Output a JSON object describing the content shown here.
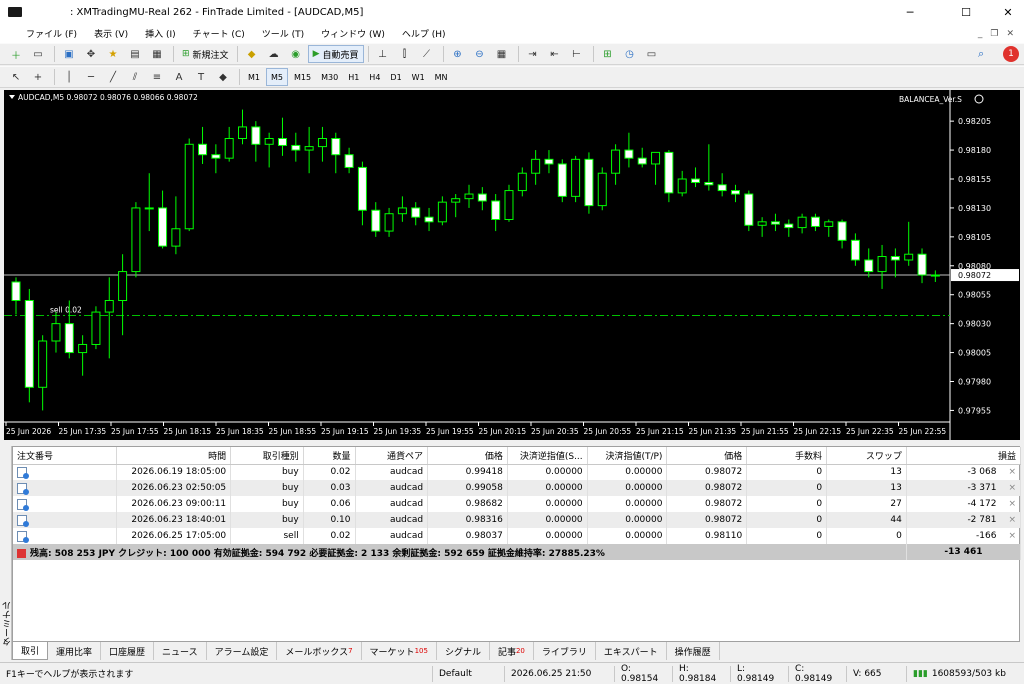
{
  "window": {
    "title": ": XMTradingMU-Real 262 - FinTrade Limited - [AUDCAD,M5]"
  },
  "menu": [
    "ファイル (F)",
    "表示 (V)",
    "挿入 (I)",
    "チャート (C)",
    "ツール (T)",
    "ウィンドウ (W)",
    "ヘルプ (H)"
  ],
  "toolbar": {
    "new_order_label": "新規注文",
    "autotrade_label": "自動売買",
    "notification_count": "1"
  },
  "timeframes": [
    "M1",
    "M5",
    "M15",
    "M30",
    "H1",
    "H4",
    "D1",
    "W1",
    "MN"
  ],
  "active_timeframe": "M5",
  "chart_data": {
    "type": "candlestick",
    "symbol_info": "AUDCAD,M5  0.98072 0.98076 0.98066 0.98072",
    "indicator_label": "BALANCEA_Ver.S",
    "current_price_label": "0.98072",
    "current_price": 0.98072,
    "order_line_label": "sell 0.02",
    "order_line_price": 0.98037,
    "ylim": [
      0.97945,
      0.98225
    ],
    "y_ticks": [
      "0.98205",
      "0.98180",
      "0.98155",
      "0.98130",
      "0.98105",
      "0.98080",
      "0.98055",
      "0.98030",
      "0.98005",
      "0.97980",
      "0.97955"
    ],
    "x_ticks": [
      "25 Jun 2026",
      "25 Jun 17:35",
      "25 Jun 17:55",
      "25 Jun 18:15",
      "25 Jun 18:35",
      "25 Jun 18:55",
      "25 Jun 19:15",
      "25 Jun 19:35",
      "25 Jun 19:55",
      "25 Jun 20:15",
      "25 Jun 20:35",
      "25 Jun 20:55",
      "25 Jun 21:15",
      "25 Jun 21:35",
      "25 Jun 21:55",
      "25 Jun 22:15",
      "25 Jun 22:35",
      "25 Jun 22:55"
    ],
    "candles": [
      [
        0.98066,
        0.9807,
        0.98038,
        0.9805
      ],
      [
        0.9805,
        0.9806,
        0.97962,
        0.97975
      ],
      [
        0.97975,
        0.9802,
        0.97955,
        0.98015
      ],
      [
        0.98015,
        0.9804,
        0.98005,
        0.9803
      ],
      [
        0.9803,
        0.9805,
        0.98,
        0.98005
      ],
      [
        0.98005,
        0.9802,
        0.97985,
        0.98012
      ],
      [
        0.98012,
        0.98045,
        0.98008,
        0.9804
      ],
      [
        0.9804,
        0.9807,
        0.98,
        0.9805
      ],
      [
        0.9805,
        0.9809,
        0.9802,
        0.98075
      ],
      [
        0.98075,
        0.98135,
        0.9807,
        0.9813
      ],
      [
        0.9813,
        0.9816,
        0.9811,
        0.9813
      ],
      [
        0.9813,
        0.98145,
        0.98095,
        0.98097
      ],
      [
        0.98097,
        0.9814,
        0.9809,
        0.98112
      ],
      [
        0.98112,
        0.9819,
        0.9811,
        0.98185
      ],
      [
        0.98185,
        0.982,
        0.98168,
        0.98176
      ],
      [
        0.98176,
        0.98185,
        0.9816,
        0.98173
      ],
      [
        0.98173,
        0.982,
        0.9817,
        0.9819
      ],
      [
        0.9819,
        0.98215,
        0.98185,
        0.982
      ],
      [
        0.982,
        0.98205,
        0.9817,
        0.98185
      ],
      [
        0.98185,
        0.98195,
        0.98165,
        0.9819
      ],
      [
        0.9819,
        0.98208,
        0.98175,
        0.98184
      ],
      [
        0.98184,
        0.98195,
        0.9817,
        0.9818
      ],
      [
        0.9818,
        0.982,
        0.9816,
        0.98183
      ],
      [
        0.98183,
        0.982,
        0.9817,
        0.9819
      ],
      [
        0.9819,
        0.98195,
        0.9816,
        0.98176
      ],
      [
        0.98176,
        0.98182,
        0.9816,
        0.98165
      ],
      [
        0.98165,
        0.9817,
        0.98115,
        0.98128
      ],
      [
        0.98128,
        0.98135,
        0.98105,
        0.9811
      ],
      [
        0.9811,
        0.9813,
        0.98105,
        0.98125
      ],
      [
        0.98125,
        0.9814,
        0.98118,
        0.9813
      ],
      [
        0.9813,
        0.98135,
        0.98115,
        0.98122
      ],
      [
        0.98122,
        0.9813,
        0.9811,
        0.98118
      ],
      [
        0.98118,
        0.9814,
        0.98115,
        0.98135
      ],
      [
        0.98135,
        0.98142,
        0.98122,
        0.98138
      ],
      [
        0.98138,
        0.9815,
        0.9813,
        0.98142
      ],
      [
        0.98142,
        0.98148,
        0.98128,
        0.98136
      ],
      [
        0.98136,
        0.98142,
        0.9811,
        0.9812
      ],
      [
        0.9812,
        0.9815,
        0.98118,
        0.98145
      ],
      [
        0.98145,
        0.98165,
        0.9814,
        0.9816
      ],
      [
        0.9816,
        0.9818,
        0.9815,
        0.98172
      ],
      [
        0.98172,
        0.9818,
        0.9816,
        0.98168
      ],
      [
        0.98168,
        0.98172,
        0.98135,
        0.9814
      ],
      [
        0.9814,
        0.98175,
        0.98135,
        0.98172
      ],
      [
        0.98172,
        0.98178,
        0.98125,
        0.98132
      ],
      [
        0.98132,
        0.98165,
        0.98128,
        0.9816
      ],
      [
        0.9816,
        0.98185,
        0.9815,
        0.9818
      ],
      [
        0.9818,
        0.98195,
        0.98165,
        0.98173
      ],
      [
        0.98173,
        0.98182,
        0.98165,
        0.98168
      ],
      [
        0.98168,
        0.98175,
        0.9815,
        0.98178
      ],
      [
        0.98178,
        0.9818,
        0.98135,
        0.98143
      ],
      [
        0.98143,
        0.98162,
        0.9814,
        0.98155
      ],
      [
        0.98155,
        0.98165,
        0.98148,
        0.98152
      ],
      [
        0.98152,
        0.98185,
        0.98145,
        0.9815
      ],
      [
        0.9815,
        0.9816,
        0.9814,
        0.98145
      ],
      [
        0.98145,
        0.9815,
        0.98135,
        0.98142
      ],
      [
        0.98142,
        0.98145,
        0.9811,
        0.98115
      ],
      [
        0.98115,
        0.98122,
        0.98105,
        0.98118
      ],
      [
        0.98118,
        0.98125,
        0.9811,
        0.98116
      ],
      [
        0.98116,
        0.9812,
        0.98105,
        0.98113
      ],
      [
        0.98113,
        0.98125,
        0.98108,
        0.98122
      ],
      [
        0.98122,
        0.98125,
        0.9811,
        0.98114
      ],
      [
        0.98114,
        0.9812,
        0.98105,
        0.98118
      ],
      [
        0.98118,
        0.9812,
        0.98095,
        0.98102
      ],
      [
        0.98102,
        0.98108,
        0.9808,
        0.98085
      ],
      [
        0.98085,
        0.98095,
        0.9807,
        0.98075
      ],
      [
        0.98075,
        0.98098,
        0.9806,
        0.98088
      ],
      [
        0.98088,
        0.98095,
        0.9807,
        0.98085
      ],
      [
        0.98085,
        0.98118,
        0.9808,
        0.9809
      ],
      [
        0.9809,
        0.98095,
        0.98065,
        0.98072
      ],
      [
        0.98072,
        0.98076,
        0.98066,
        0.98072
      ]
    ]
  },
  "orders": {
    "columns": [
      "注文番号",
      "時間",
      "取引種別",
      "数量",
      "通貨ペア",
      "価格",
      "決済逆指値(S...",
      "決済指値(T/P)",
      "価格",
      "手数料",
      "スワップ",
      "損益"
    ],
    "rows": [
      [
        "",
        "2026.06.19 18:05:00",
        "buy",
        "0.02",
        "audcad",
        "0.99418",
        "0.00000",
        "0.00000",
        "0.98072",
        "0",
        "13",
        "-3 068"
      ],
      [
        "",
        "2026.06.23 02:50:05",
        "buy",
        "0.03",
        "audcad",
        "0.99058",
        "0.00000",
        "0.00000",
        "0.98072",
        "0",
        "13",
        "-3 371"
      ],
      [
        "",
        "2026.06.23 09:00:11",
        "buy",
        "0.06",
        "audcad",
        "0.98682",
        "0.00000",
        "0.00000",
        "0.98072",
        "0",
        "27",
        "-4 172"
      ],
      [
        "",
        "2026.06.23 18:40:01",
        "buy",
        "0.10",
        "audcad",
        "0.98316",
        "0.00000",
        "0.00000",
        "0.98072",
        "0",
        "44",
        "-2 781"
      ],
      [
        "",
        "2026.06.25 17:05:00",
        "sell",
        "0.02",
        "audcad",
        "0.98037",
        "0.00000",
        "0.00000",
        "0.98110",
        "0",
        "0",
        "-166"
      ]
    ],
    "close_glyph": "×",
    "summary": "残高: 508 253 JPY  クレジット: 100 000  有効証拠金: 594 792  必要証拠金: 2 133  余剰証拠金: 592 659  証拠金維持率: 27885.23%",
    "summary_total": "-13 461"
  },
  "terminal_label": "ターミナル",
  "tabs": [
    {
      "label": "取引",
      "badge": ""
    },
    {
      "label": "運用比率",
      "badge": ""
    },
    {
      "label": "口座履歴",
      "badge": ""
    },
    {
      "label": "ニュース",
      "badge": ""
    },
    {
      "label": "アラーム設定",
      "badge": ""
    },
    {
      "label": "メールボックス",
      "badge": "7"
    },
    {
      "label": "マーケット",
      "badge": "105"
    },
    {
      "label": "シグナル",
      "badge": ""
    },
    {
      "label": "記事",
      "badge": "20"
    },
    {
      "label": "ライブラリ",
      "badge": ""
    },
    {
      "label": "エキスパート",
      "badge": ""
    },
    {
      "label": "操作履歴",
      "badge": ""
    }
  ],
  "status": {
    "help": "F1キーでヘルプが表示されます",
    "profile": "Default",
    "datetime": "2026.06.25 21:50",
    "open": "O: 0.98154",
    "high": "H: 0.98184",
    "low": "L: 0.98149",
    "close": "C: 0.98149",
    "volume": "V: 665",
    "traffic": "1608593/503 kb"
  },
  "colors": {
    "bull": "#00ff00",
    "bear_body": "#ffffff",
    "background": "#000000",
    "grid_text": "#ffffff",
    "order_line": "#00c000"
  }
}
